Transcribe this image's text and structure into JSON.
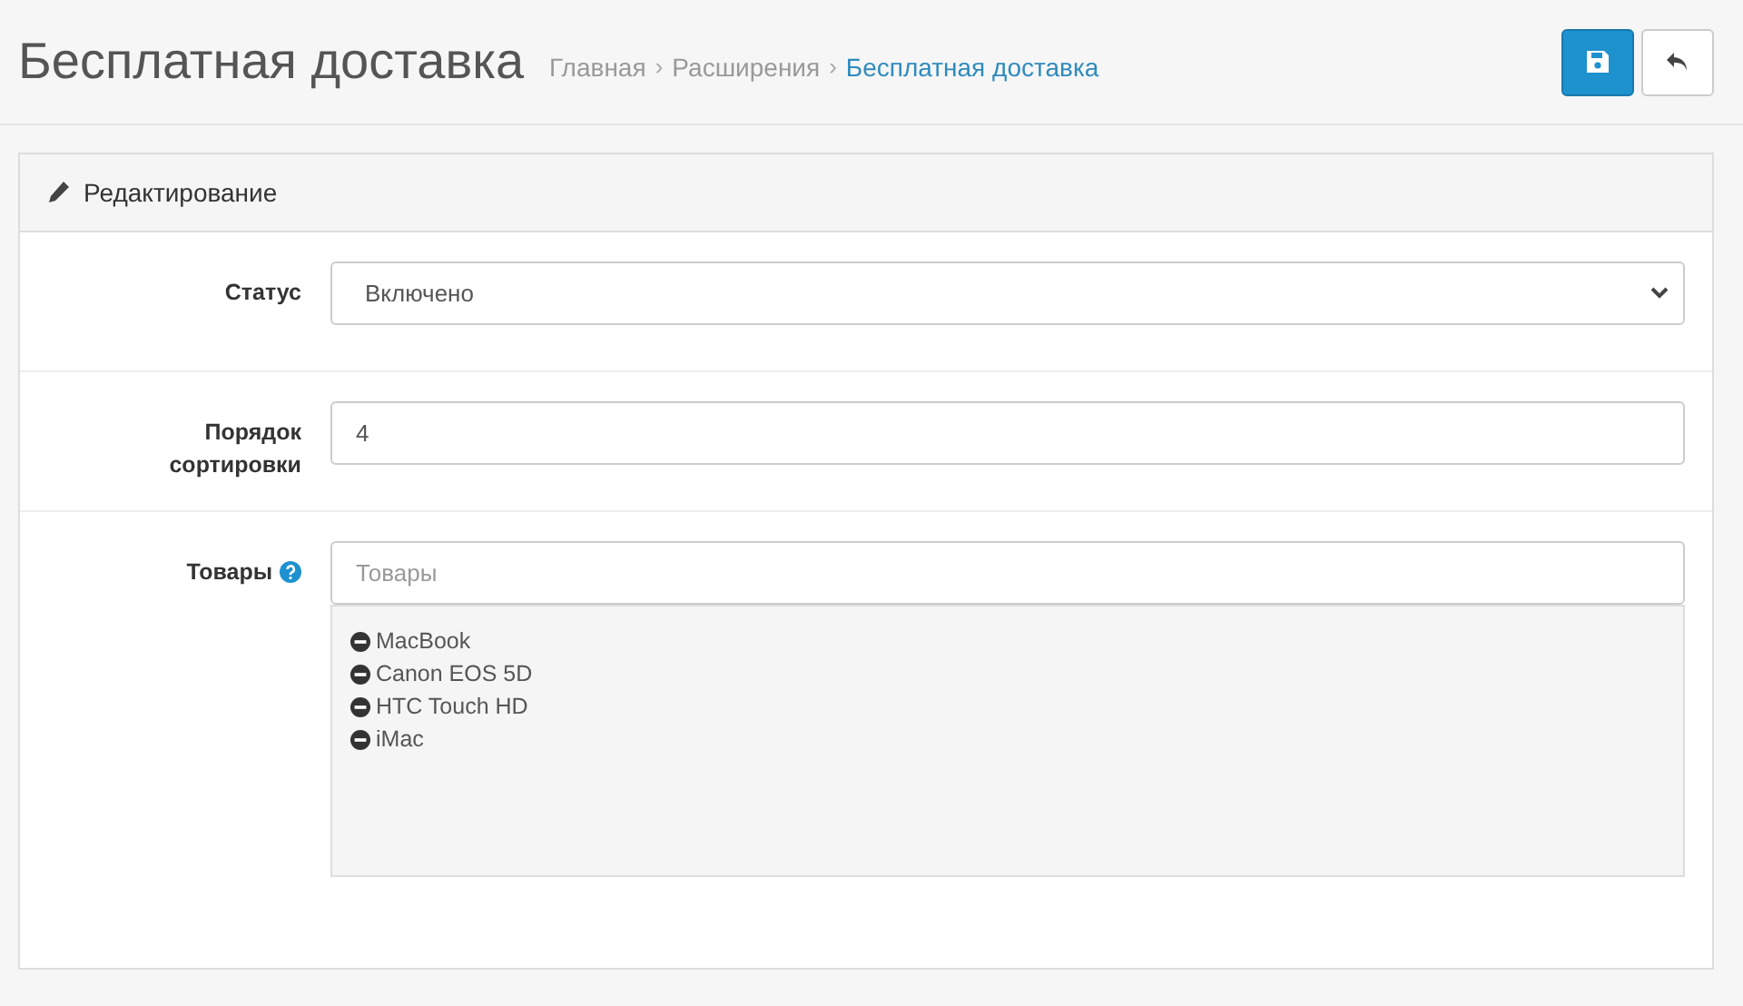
{
  "page": {
    "title": "Бесплатная доставка"
  },
  "breadcrumbs": [
    {
      "label": "Главная",
      "selected": false
    },
    {
      "separator": "›",
      "label": "Расширения",
      "selected": false
    },
    {
      "separator": "›",
      "label": "Бесплатная доставка",
      "selected": true
    }
  ],
  "panel": {
    "heading": "Редактирование"
  },
  "fields": [
    {
      "kind": "select",
      "label": "Статус",
      "value": "Включено"
    },
    {
      "kind": "text",
      "label": "Порядок сортировки",
      "value": "4"
    },
    {
      "kind": "autocomplete",
      "label": "Товары",
      "help": true,
      "placeholder": "Товары",
      "items": [
        "MacBook",
        "Canon EOS 5D",
        "HTC Touch HD",
        "iMac"
      ]
    }
  ]
}
